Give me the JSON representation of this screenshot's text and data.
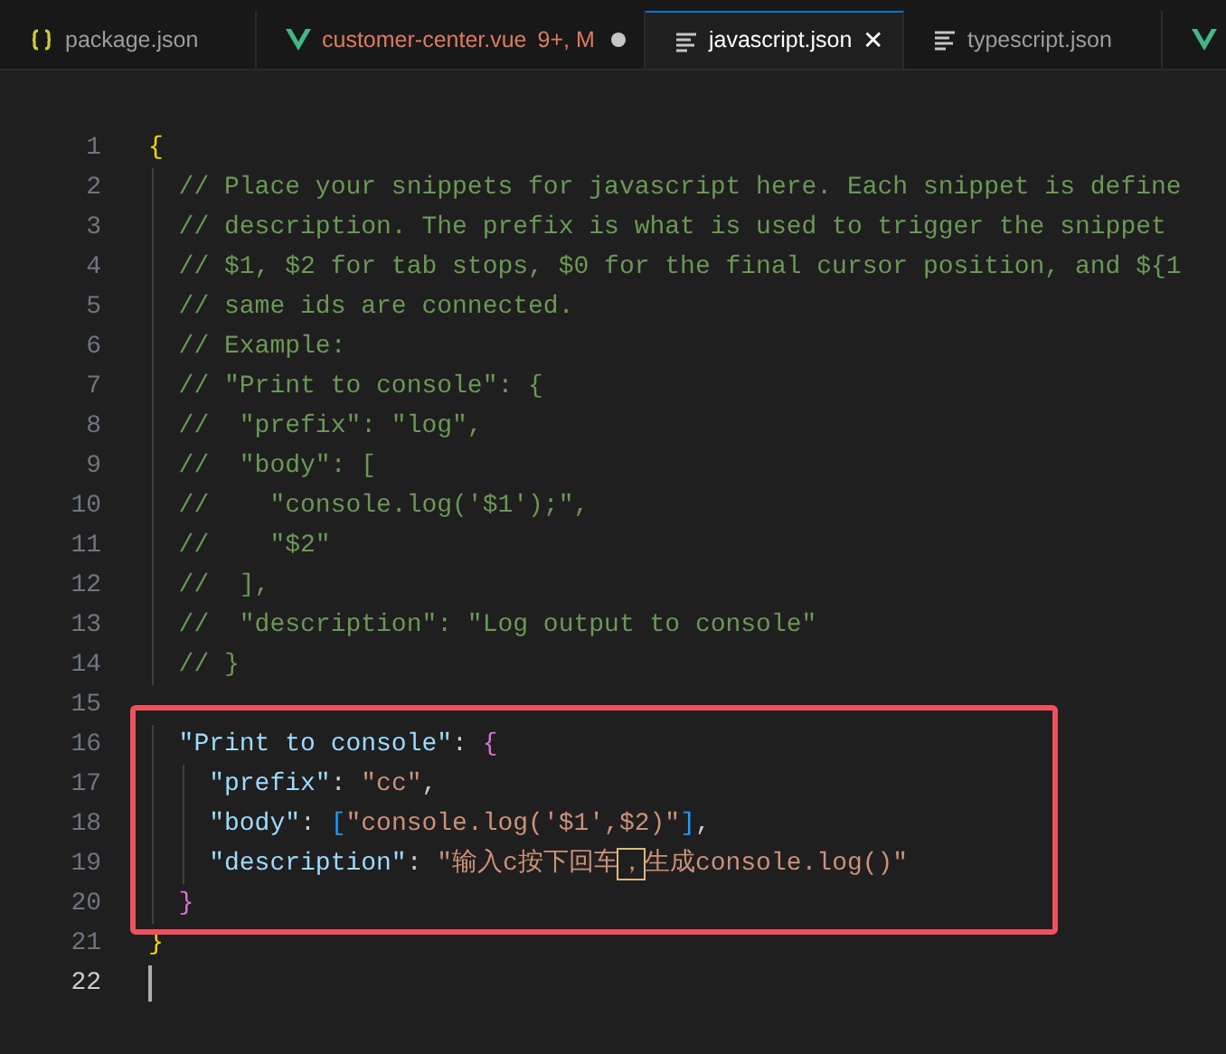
{
  "tabs": [
    {
      "label": "package.json",
      "kind": "json",
      "selected": false
    },
    {
      "label": "customer-center.vue",
      "kind": "vue",
      "selected": false,
      "modified": true,
      "status": "9+, M"
    },
    {
      "label": "javascript.json",
      "kind": "snippets",
      "selected": true,
      "close": "✕"
    },
    {
      "label": "typescript.json",
      "kind": "snippets",
      "selected": false
    },
    {
      "kind": "vue",
      "selected": false
    }
  ],
  "editor": {
    "lines": [
      {
        "number": "1",
        "tokens": [
          {
            "kind": "brace",
            "text": "{"
          }
        ]
      },
      {
        "number": "2",
        "tokens": [
          {
            "kind": "comment",
            "text": "  // Place your snippets for javascript here. Each snippet is define"
          }
        ]
      },
      {
        "number": "3",
        "tokens": [
          {
            "kind": "comment",
            "text": "  // description. The prefix is what is used to trigger the snippet"
          }
        ]
      },
      {
        "number": "4",
        "tokens": [
          {
            "kind": "comment",
            "text": "  // $1, $2 for tab stops, $0 for the final cursor position, and ${1"
          }
        ]
      },
      {
        "number": "5",
        "tokens": [
          {
            "kind": "comment",
            "text": "  // same ids are connected."
          }
        ]
      },
      {
        "number": "6",
        "tokens": [
          {
            "kind": "comment",
            "text": "  // Example:"
          }
        ]
      },
      {
        "number": "7",
        "tokens": [
          {
            "kind": "comment",
            "text": "  // \"Print to console\": {"
          }
        ]
      },
      {
        "number": "8",
        "tokens": [
          {
            "kind": "comment",
            "text": "  //  \"prefix\": \"log\","
          }
        ]
      },
      {
        "number": "9",
        "tokens": [
          {
            "kind": "comment",
            "text": "  //  \"body\": ["
          }
        ]
      },
      {
        "number": "10",
        "tokens": [
          {
            "kind": "comment",
            "text": "  //    \"console.log('$1');\","
          }
        ]
      },
      {
        "number": "11",
        "tokens": [
          {
            "kind": "comment",
            "text": "  //    \"$2\""
          }
        ]
      },
      {
        "number": "12",
        "tokens": [
          {
            "kind": "comment",
            "text": "  //  ],"
          }
        ]
      },
      {
        "number": "13",
        "tokens": [
          {
            "kind": "comment",
            "text": "  //  \"description\": \"Log output to console\""
          }
        ]
      },
      {
        "number": "14",
        "tokens": [
          {
            "kind": "comment",
            "text": "  // }"
          }
        ]
      },
      {
        "number": "15"
      },
      {
        "number": "16",
        "tokens": [
          {
            "kind": "key",
            "text": "  \"Print to console\""
          },
          {
            "kind": "punct",
            "text": ": "
          },
          {
            "kind": "brace2",
            "text": "{"
          }
        ]
      },
      {
        "number": "17",
        "tokens": [
          {
            "kind": "key",
            "text": "    \"prefix\""
          },
          {
            "kind": "punct",
            "text": ": "
          },
          {
            "kind": "string",
            "text": "\"cc\""
          },
          {
            "kind": "punct",
            "text": ","
          }
        ]
      },
      {
        "number": "18",
        "tokens": [
          {
            "kind": "key",
            "text": "    \"body\""
          },
          {
            "kind": "punct",
            "text": ": "
          },
          {
            "kind": "bracket",
            "text": "["
          },
          {
            "kind": "string",
            "text": "\"console.log('$1',$2)\""
          },
          {
            "kind": "bracket",
            "text": "]"
          },
          {
            "kind": "punct",
            "text": ","
          }
        ]
      },
      {
        "number": "19",
        "tokens": [
          {
            "kind": "key",
            "text": "    \"description\""
          },
          {
            "kind": "punct",
            "text": ": "
          },
          {
            "kind": "string",
            "text": "\"输入c按下回车"
          },
          {
            "kind": "ambiguous",
            "text": "，"
          },
          {
            "kind": "string",
            "text": "生成console.log()\""
          }
        ]
      },
      {
        "number": "20",
        "tokens": [
          {
            "kind": "brace2",
            "text": "  }"
          }
        ]
      },
      {
        "number": "21",
        "tokens": [
          {
            "kind": "brace",
            "text": "}"
          }
        ]
      },
      {
        "number": "22",
        "cursor": true
      }
    ]
  }
}
